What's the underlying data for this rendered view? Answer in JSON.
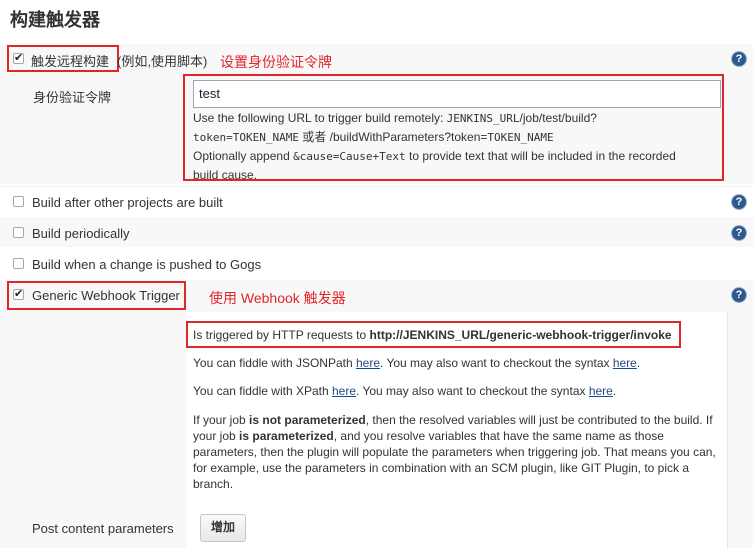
{
  "page_title": "构建触发器",
  "remote_trigger": {
    "label": "触发远程构建",
    "suffix": "(例如,使用脚本)",
    "annotation": "设置身份验证令牌",
    "token_label": "身份验证令牌",
    "token_value": "test",
    "hint_line1_prefix": "Use the following URL to trigger build remotely: ",
    "hint_line1_code": "JENKINS_URL",
    "hint_line1_suffix": "/job/test/build?",
    "hint_line2_code1": "token=TOKEN_NAME",
    "hint_line2_mid": " 或者 /buildWithParameters?token=",
    "hint_line2_code2": "TOKEN_NAME",
    "hint_line3_prefix": "Optionally append ",
    "hint_line3_code": "&cause=Cause+Text",
    "hint_line3_suffix": " to provide text that will be included in the recorded",
    "hint_line4": "build cause.",
    "checked": true
  },
  "options": [
    {
      "label": "Build after other projects are built",
      "checked": false
    },
    {
      "label": "Build periodically",
      "checked": false
    },
    {
      "label": "Build when a change is pushed to Gogs",
      "checked": false
    }
  ],
  "webhook": {
    "label": "Generic Webhook Trigger",
    "annotation": "使用 Webhook 触发器",
    "checked": true,
    "url_prefix": "Is triggered by HTTP requests to ",
    "url_bold": "http://JENKINS_URL/generic-webhook-trigger/invoke",
    "json_line_a": "You can fiddle with JSONPath ",
    "json_link1": "here",
    "json_line_b": ". You may also want to checkout the syntax ",
    "json_link2": "here",
    "json_line_c": ".",
    "xpath_line_a": "You can fiddle with XPath ",
    "xpath_link1": "here",
    "xpath_line_b": ". You may also want to checkout the syntax ",
    "xpath_link2": "here",
    "xpath_line_c": ".",
    "para_1a": "If your job ",
    "para_1b": "is not parameterized",
    "para_1c": ", then the resolved variables will just be contributed to the build. If",
    "para_2a": "your job ",
    "para_2b": "is parameterized",
    "para_2c": ", and you resolve variables that have the same name as those",
    "para_3": "parameters, then the plugin will populate the parameters when triggering job. That means you can,",
    "para_4": "for example, use the parameters in combination with an SCM plugin, like GIT Plugin, to pick a",
    "para_5": "branch.",
    "post_params_label": "Post content parameters",
    "add_button": "增加"
  },
  "help_glyph": "?"
}
